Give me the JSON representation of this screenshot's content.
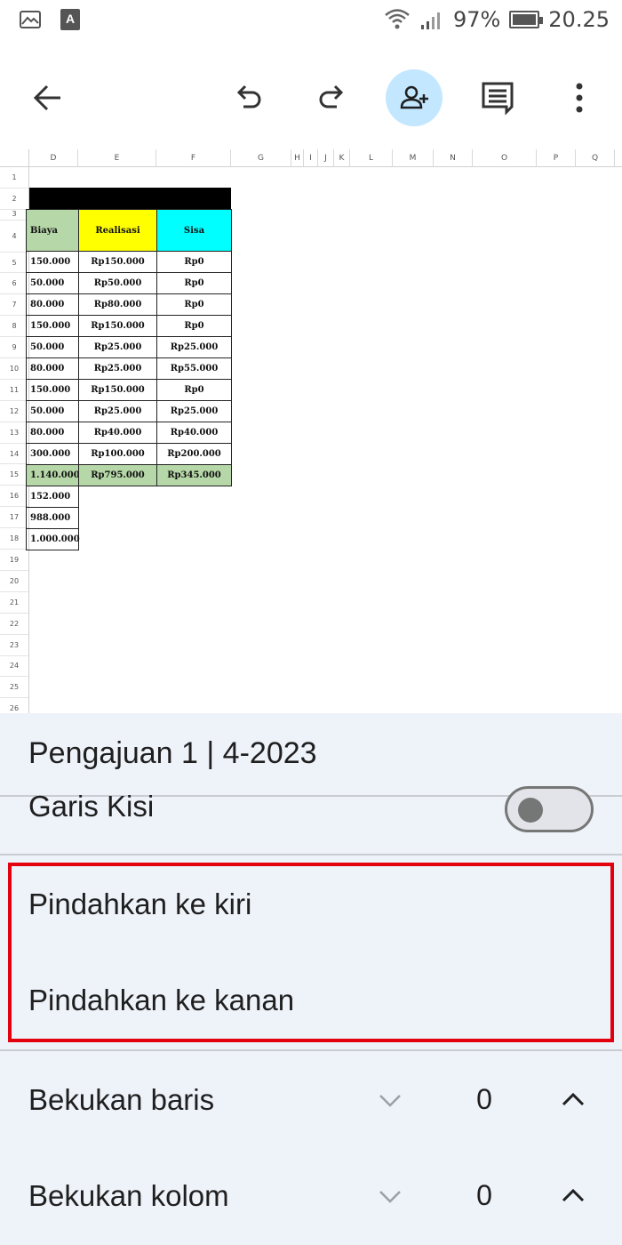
{
  "status_bar": {
    "battery": "97%",
    "time": "20.25"
  },
  "toolbar": {
    "back_icon": "arrow-left-icon",
    "undo_icon": "undo-icon",
    "redo_icon": "redo-icon",
    "share_icon": "person-add-icon",
    "comment_icon": "comment-icon",
    "more_icon": "more-vert-icon"
  },
  "sheet": {
    "columns": [
      "D",
      "E",
      "F",
      "G",
      "H",
      "I",
      "J",
      "K",
      "L",
      "M",
      "N",
      "O",
      "P",
      "Q"
    ],
    "rows": [
      "1",
      "2",
      "3",
      "4",
      "5",
      "6",
      "7",
      "8",
      "9",
      "10",
      "11",
      "12",
      "13",
      "14",
      "15",
      "16",
      "17",
      "18",
      "19",
      "20",
      "21",
      "22",
      "23",
      "24",
      "25",
      "26"
    ],
    "headers": {
      "biaya": "Biaya",
      "realisasi": "Realisasi",
      "sisa": "Sisa"
    },
    "data_rows": [
      {
        "d": "150.000",
        "e": "Rp150.000",
        "f": "Rp0"
      },
      {
        "d": "50.000",
        "e": "Rp50.000",
        "f": "Rp0"
      },
      {
        "d": "80.000",
        "e": "Rp80.000",
        "f": "Rp0"
      },
      {
        "d": "150.000",
        "e": "Rp150.000",
        "f": "Rp0"
      },
      {
        "d": "50.000",
        "e": "Rp25.000",
        "f": "Rp25.000"
      },
      {
        "d": "80.000",
        "e": "Rp25.000",
        "f": "Rp55.000"
      },
      {
        "d": "150.000",
        "e": "Rp150.000",
        "f": "Rp0"
      },
      {
        "d": "50.000",
        "e": "Rp25.000",
        "f": "Rp25.000"
      },
      {
        "d": "80.000",
        "e": "Rp40.000",
        "f": "Rp40.000"
      },
      {
        "d": "300.000",
        "e": "Rp100.000",
        "f": "Rp200.000"
      }
    ],
    "total_row": {
      "d": "1.140.000",
      "e": "Rp795.000",
      "f": "Rp345.000"
    },
    "extra_rows": [
      "152.000",
      "988.000",
      "1.000.000"
    ],
    "colors": {
      "biaya_header": "#b6d7a8",
      "realisasi_header": "#ffff00",
      "sisa_header": "#00ffff",
      "total_row": "#b6d7a8"
    }
  },
  "panel": {
    "title": "Pengajuan 1 | 4-2023",
    "gridlines_label": "Garis Kisi",
    "gridlines_on": false,
    "move_left": "Pindahkan ke kiri",
    "move_right": "Pindahkan ke kanan",
    "freeze_rows_label": "Bekukan baris",
    "freeze_rows_value": "0",
    "freeze_cols_label": "Bekukan kolom",
    "freeze_cols_value": "0",
    "highlight_color": "#e3000f"
  }
}
